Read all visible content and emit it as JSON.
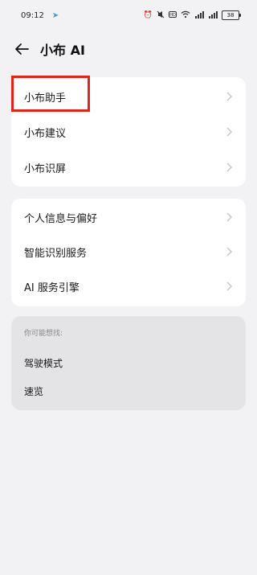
{
  "status_bar": {
    "time": "09:12",
    "battery": "38"
  },
  "header": {
    "title": "小布 AI"
  },
  "group1": {
    "items": [
      {
        "label": "小布助手"
      },
      {
        "label": "小布建议"
      },
      {
        "label": "小布识屏"
      }
    ]
  },
  "group2": {
    "items": [
      {
        "label": "个人信息与偏好"
      },
      {
        "label": "智能识别服务"
      },
      {
        "label": "AI 服务引擎"
      }
    ]
  },
  "group3": {
    "hint": "你可能想找:",
    "items": [
      {
        "label": "驾驶模式"
      },
      {
        "label": "速览"
      }
    ]
  },
  "colors": {
    "background": "#f2f2f4",
    "card": "#ffffff",
    "highlight": "#e2231a"
  }
}
